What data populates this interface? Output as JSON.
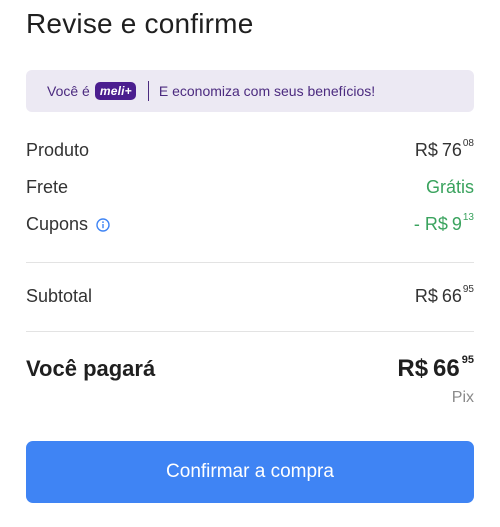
{
  "header": {
    "title": "Revise e confirme"
  },
  "banner": {
    "prefix": "Você é",
    "badge": "meli+",
    "message": "E economiza com seus benefícios!"
  },
  "summary": {
    "produto": {
      "label": "Produto",
      "currency": "R$",
      "integer": "76",
      "cents": "08"
    },
    "frete": {
      "label": "Frete",
      "value": "Grátis"
    },
    "cupons": {
      "label": "Cupons",
      "currency": "- R$",
      "integer": "9",
      "cents": "13"
    },
    "subtotal": {
      "label": "Subtotal",
      "currency": "R$",
      "integer": "66",
      "cents": "95"
    }
  },
  "total": {
    "label": "Você pagará",
    "currency": "R$",
    "integer": "66",
    "cents": "95",
    "method": "Pix"
  },
  "actions": {
    "confirm_label": "Confirmar a compra"
  },
  "colors": {
    "accent": "#3f84f4",
    "green": "#3aa35e",
    "meli_purple": "#4b1e8f",
    "banner_bg": "#ece9f3"
  }
}
